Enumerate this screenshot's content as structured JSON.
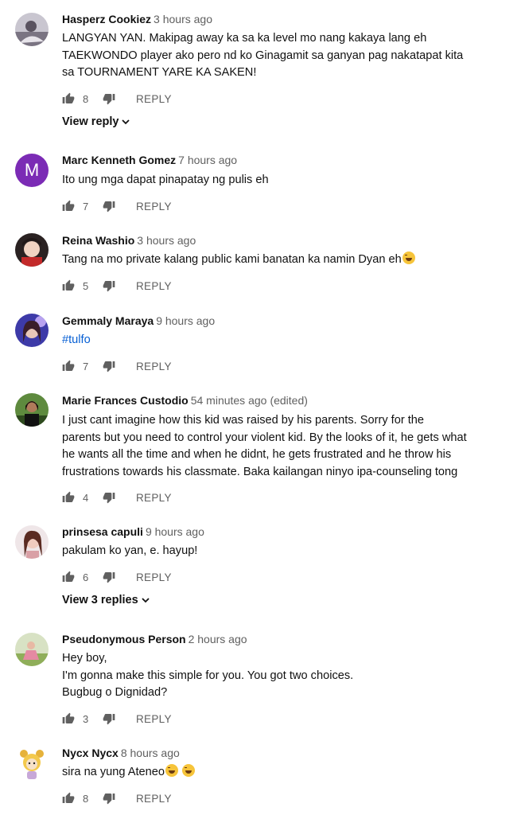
{
  "action_labels": {
    "reply": "REPLY"
  },
  "comments": [
    {
      "author": "Hasperz Cookiez",
      "time": "3 hours ago",
      "text": "LANGYAN YAN.  Makipag away ka sa ka level mo nang kakaya lang eh\nTAEKWONDO player ako pero nd ko Ginagamit sa ganyan  pag nakatapat kita\nsa TOURNAMENT  YARE KA SAKEN!",
      "likes": "8",
      "view_replies": "View reply"
    },
    {
      "author": "Marc Kenneth Gomez",
      "time": "7 hours ago",
      "avatar_letter": "M",
      "text": "Ito ung mga dapat pinapatay ng pulis eh",
      "likes": "7"
    },
    {
      "author": "Reina Washio",
      "time": "3 hours ago",
      "text": "Tang na mo private kalang public kami banatan ka namin Dyan eh",
      "likes": "5"
    },
    {
      "author": "Gemmaly Maraya",
      "time": "9 hours ago",
      "text": "#tulfo",
      "likes": "7"
    },
    {
      "author": "Marie Frances Custodio",
      "time": "54 minutes ago",
      "edited": "(edited)",
      "text": "I just cant imagine how this kid was raised by his parents.  Sorry for the\nparents but you need to control your violent kid. By the looks of it, he gets what\nhe wants all the time and when he didnt, he gets frustrated and he throw his\nfrustrations towards his classmate. Baka kailangan ninyo ipa-counseling tong",
      "likes": "4"
    },
    {
      "author": "prinsesa capuli",
      "time": "9 hours ago",
      "text": "pakulam ko yan, e. hayup!",
      "likes": "6",
      "view_replies": "View 3 replies"
    },
    {
      "author": "Pseudonymous Person",
      "time": "2 hours ago",
      "text": "Hey boy,\nI'm gonna make this simple for you. You got two choices.\nBugbug o Dignidad?",
      "likes": "3"
    },
    {
      "author": "Nycx Nycx",
      "time": "8 hours ago",
      "text": "sira na yung Ateneo",
      "likes": "8"
    }
  ],
  "colors": {
    "link": "#065fd4",
    "meta": "#606060",
    "avatar_m": "#7b2bb5"
  }
}
